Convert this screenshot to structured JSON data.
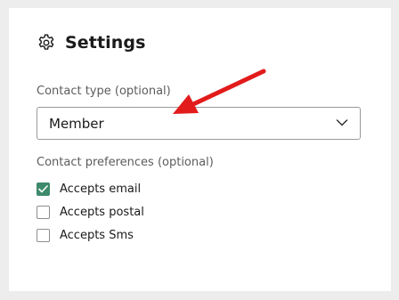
{
  "settings": {
    "title": "Settings",
    "contact_type": {
      "label": "Contact type (optional)",
      "selected": "Member"
    },
    "contact_preferences": {
      "label": "Contact preferences (optional)",
      "options": [
        {
          "label": "Accepts email",
          "checked": true
        },
        {
          "label": "Accepts postal",
          "checked": false
        },
        {
          "label": "Accepts Sms",
          "checked": false
        }
      ]
    }
  },
  "colors": {
    "background": "#ededed",
    "card": "#ffffff",
    "checkbox_checked": "#3e8a6c",
    "annotation_arrow": "#e21b1b"
  },
  "icons": {
    "title": "gear-icon",
    "select": "chevron-down-icon",
    "checkbox": "checkmark-icon",
    "annotation": "red-arrow-annotation"
  }
}
